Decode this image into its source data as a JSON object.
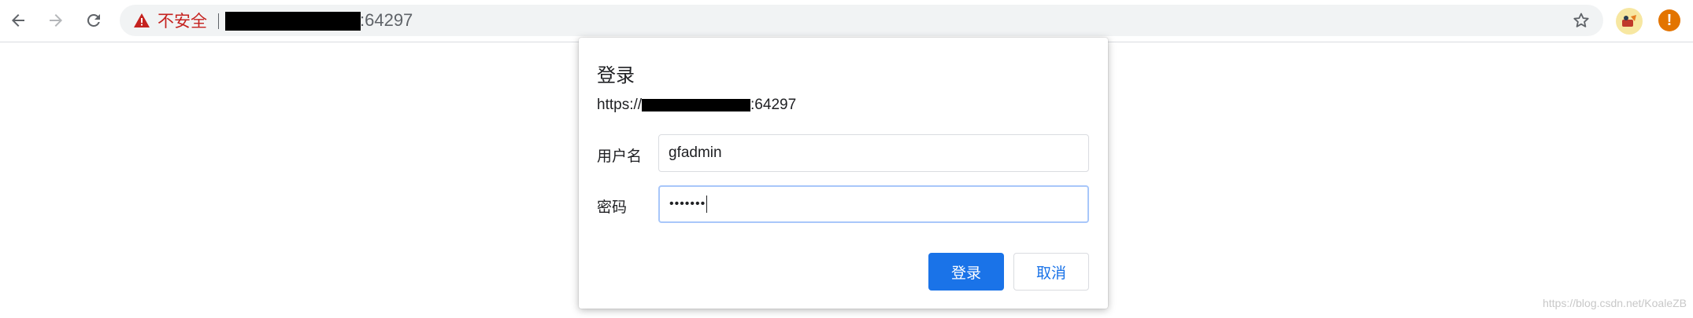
{
  "browser": {
    "security_label": "不安全",
    "url_visible_suffix": ":64297"
  },
  "dialog": {
    "title": "登录",
    "origin_prefix": "https://",
    "origin_suffix": ":64297",
    "username_label": "用户名",
    "username_value": "gfadmin",
    "password_label": "密码",
    "password_masked": "•••••••",
    "login_button": "登录",
    "cancel_button": "取消"
  },
  "watermark": "https://blog.csdn.net/KoaleZB",
  "colors": {
    "accent": "#1a73e8",
    "warning": "#c5221f",
    "alert": "#e37400"
  },
  "icons": {
    "back": "back-arrow-icon",
    "forward": "forward-arrow-icon",
    "reload": "reload-icon",
    "warning": "warning-triangle-icon",
    "bookmark": "star-icon",
    "extension": "extension-icon",
    "alert": "alert-icon"
  }
}
